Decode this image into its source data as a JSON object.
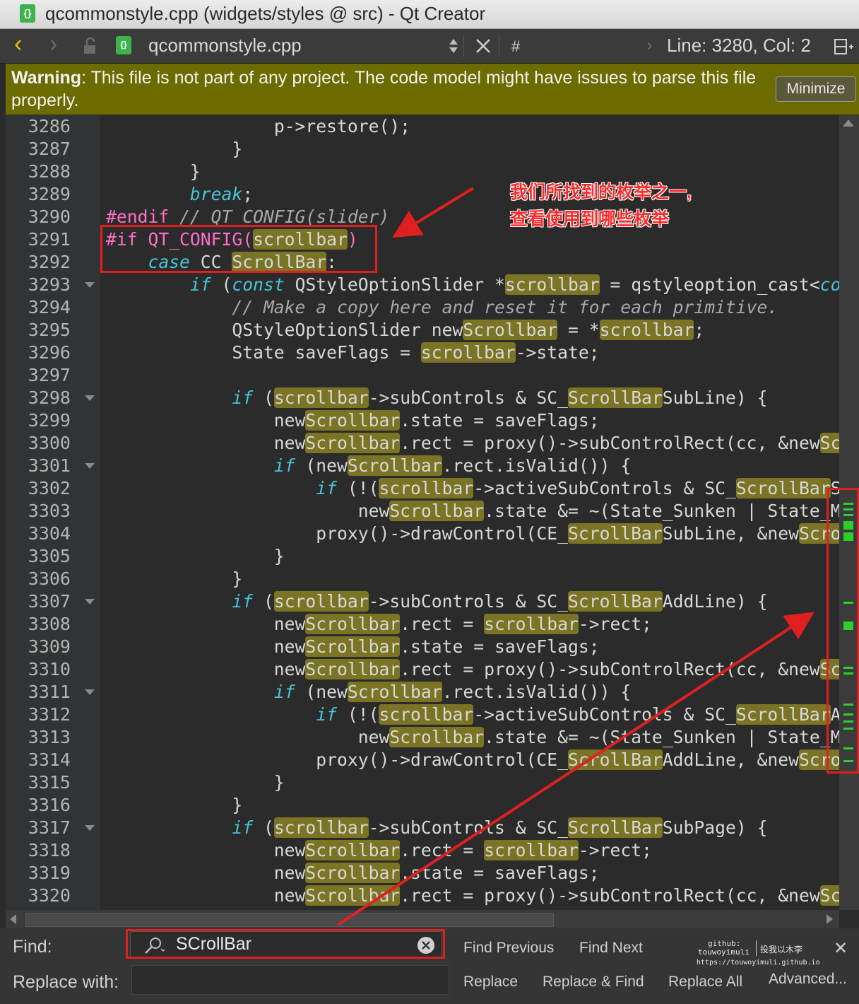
{
  "window": {
    "title": "qcommonstyle.cpp (widgets/styles @ src) - Qt Creator",
    "app_icon": "{}",
    "file_icon": "{}"
  },
  "toolbar": {
    "back_icon": "‹",
    "forward_icon": "›",
    "file_name": "qcommonstyle.cpp",
    "hash": "#",
    "line_col": "Line: 3280, Col: 2"
  },
  "warning": {
    "label": "Warning",
    "message": ": This file is not part of any project. The code model might have issues to parse this file properly.",
    "minimize_label": "Minimize"
  },
  "editor": {
    "lines": [
      {
        "num": "3286",
        "html": "                <span>p-&gt;restore();</span>"
      },
      {
        "num": "3287",
        "html": "            }"
      },
      {
        "num": "3288",
        "html": "        }"
      },
      {
        "num": "3289",
        "html": "        <span class=\"kw\">break</span>;"
      },
      {
        "num": "3290",
        "html": "<span class=\"pp\">#endif</span> <span class=\"cm\">// QT_CONFIG(slider)</span>"
      },
      {
        "num": "3291",
        "html": "<span class=\"pp\">#if QT_CONFIG(</span><span class=\"hl\">scrollbar</span><span class=\"pp\">)</span>"
      },
      {
        "num": "3292",
        "html": "    <span class=\"kw\">case</span> CC_<span class=\"hl\">ScrollBar</span>:"
      },
      {
        "num": "3293",
        "html": "        <span class=\"kw\">if</span> (<span class=\"kw\">const</span> QStyleOptionSlider *<span class=\"hl\">scrollbar</span> = qstyleoption_cast&lt;<span class=\"kw\">cons</span>",
        "fold": true
      },
      {
        "num": "3294",
        "html": "            <span class=\"cm\">// Make a copy here and reset it for each primitive.</span>"
      },
      {
        "num": "3295",
        "html": "            QStyleOptionSlider new<span class=\"hl\">Scrollbar</span> = *<span class=\"hl\">scrollbar</span>;"
      },
      {
        "num": "3296",
        "html": "            State saveFlags = <span class=\"hl\">scrollbar</span>-&gt;state;"
      },
      {
        "num": "3297",
        "html": ""
      },
      {
        "num": "3298",
        "html": "            <span class=\"kw\">if</span> (<span class=\"hl\">scrollbar</span>-&gt;subControls &amp; SC_<span class=\"hl\">ScrollBar</span>SubLine) {",
        "fold": true
      },
      {
        "num": "3299",
        "html": "                new<span class=\"hl\">Scrollbar</span>.state = saveFlags;"
      },
      {
        "num": "3300",
        "html": "                new<span class=\"hl\">Scrollbar</span>.rect = proxy()-&gt;subControlRect(cc, &amp;new<span class=\"hl\">Scro</span>"
      },
      {
        "num": "3301",
        "html": "                <span class=\"kw\">if</span> (new<span class=\"hl\">Scrollbar</span>.rect.isValid()) {",
        "fold": true
      },
      {
        "num": "3302",
        "html": "                    <span class=\"kw\">if</span> (!(<span class=\"hl\">scrollbar</span>-&gt;activeSubControls &amp; SC_<span class=\"hl\">ScrollBar</span>Sub"
      },
      {
        "num": "3303",
        "html": "                        new<span class=\"hl\">Scrollbar</span>.state &amp;= ~(State_Sunken | State_Mou"
      },
      {
        "num": "3304",
        "html": "                    proxy()-&gt;drawControl(CE_<span class=\"hl\">ScrollBar</span>SubLine, &amp;new<span class=\"hl\">Scroll</span>"
      },
      {
        "num": "3305",
        "html": "                }"
      },
      {
        "num": "3306",
        "html": "            }"
      },
      {
        "num": "3307",
        "html": "            <span class=\"kw\">if</span> (<span class=\"hl\">scrollbar</span>-&gt;subControls &amp; SC_<span class=\"hl\">ScrollBar</span>AddLine) {",
        "fold": true
      },
      {
        "num": "3308",
        "html": "                new<span class=\"hl\">Scrollbar</span>.rect = <span class=\"hl\">scrollbar</span>-&gt;rect;"
      },
      {
        "num": "3309",
        "html": "                new<span class=\"hl\">Scrollbar</span>.state = saveFlags;"
      },
      {
        "num": "3310",
        "html": "                new<span class=\"hl\">Scrollbar</span>.rect = proxy()-&gt;subControlRect(cc, &amp;new<span class=\"hl\">Scro</span>"
      },
      {
        "num": "3311",
        "html": "                <span class=\"kw\">if</span> (new<span class=\"hl\">Scrollbar</span>.rect.isValid()) {",
        "fold": true
      },
      {
        "num": "3312",
        "html": "                    <span class=\"kw\">if</span> (!(<span class=\"hl\">scrollbar</span>-&gt;activeSubControls &amp; SC_<span class=\"hl\">ScrollBar</span>Add"
      },
      {
        "num": "3313",
        "html": "                        new<span class=\"hl\">Scrollbar</span>.state &amp;= ~(State_Sunken | State_Mou"
      },
      {
        "num": "3314",
        "html": "                    proxy()-&gt;drawControl(CE_<span class=\"hl\">ScrollBar</span>AddLine, &amp;new<span class=\"hl\">Scroll</span>"
      },
      {
        "num": "3315",
        "html": "                }"
      },
      {
        "num": "3316",
        "html": "            }"
      },
      {
        "num": "3317",
        "html": "            <span class=\"kw\">if</span> (<span class=\"hl\">scrollbar</span>-&gt;subControls &amp; SC_<span class=\"hl\">ScrollBar</span>SubPage) {",
        "fold": true
      },
      {
        "num": "3318",
        "html": "                new<span class=\"hl\">Scrollbar</span>.rect = <span class=\"hl\">scrollbar</span>-&gt;rect;"
      },
      {
        "num": "3319",
        "html": "                new<span class=\"hl\">Scrollbar</span>.state = saveFlags;"
      },
      {
        "num": "3320",
        "html": "                new<span class=\"hl\">Scrollbar</span>.rect = proxy()-&gt;subControlRect(cc, &amp;new<span class=\"hl\">Scro</span>"
      }
    ]
  },
  "annotation": {
    "line1": "我们所找到的枚举之一,",
    "line2": "查看使用到哪些枚举"
  },
  "find": {
    "find_label": "Find:",
    "find_value": "SCrollBar",
    "replace_label": "Replace with:",
    "replace_value": "",
    "find_previous": "Find Previous",
    "find_next": "Find Next",
    "replace": "Replace",
    "replace_find": "Replace & Find",
    "replace_all": "Replace All",
    "advanced": "Advanced...",
    "close_icon": "✕"
  },
  "watermark": {
    "line1": "github:",
    "line2": "touwoyimuli",
    "line3": "https://touwoyimuli.github.io",
    "cn": "投我以木李"
  },
  "colors": {
    "highlight": "#7b7424",
    "warning_bg": "#6b6b00",
    "annotation_red": "#e02020",
    "scroll_marks": "#2bd12b"
  }
}
